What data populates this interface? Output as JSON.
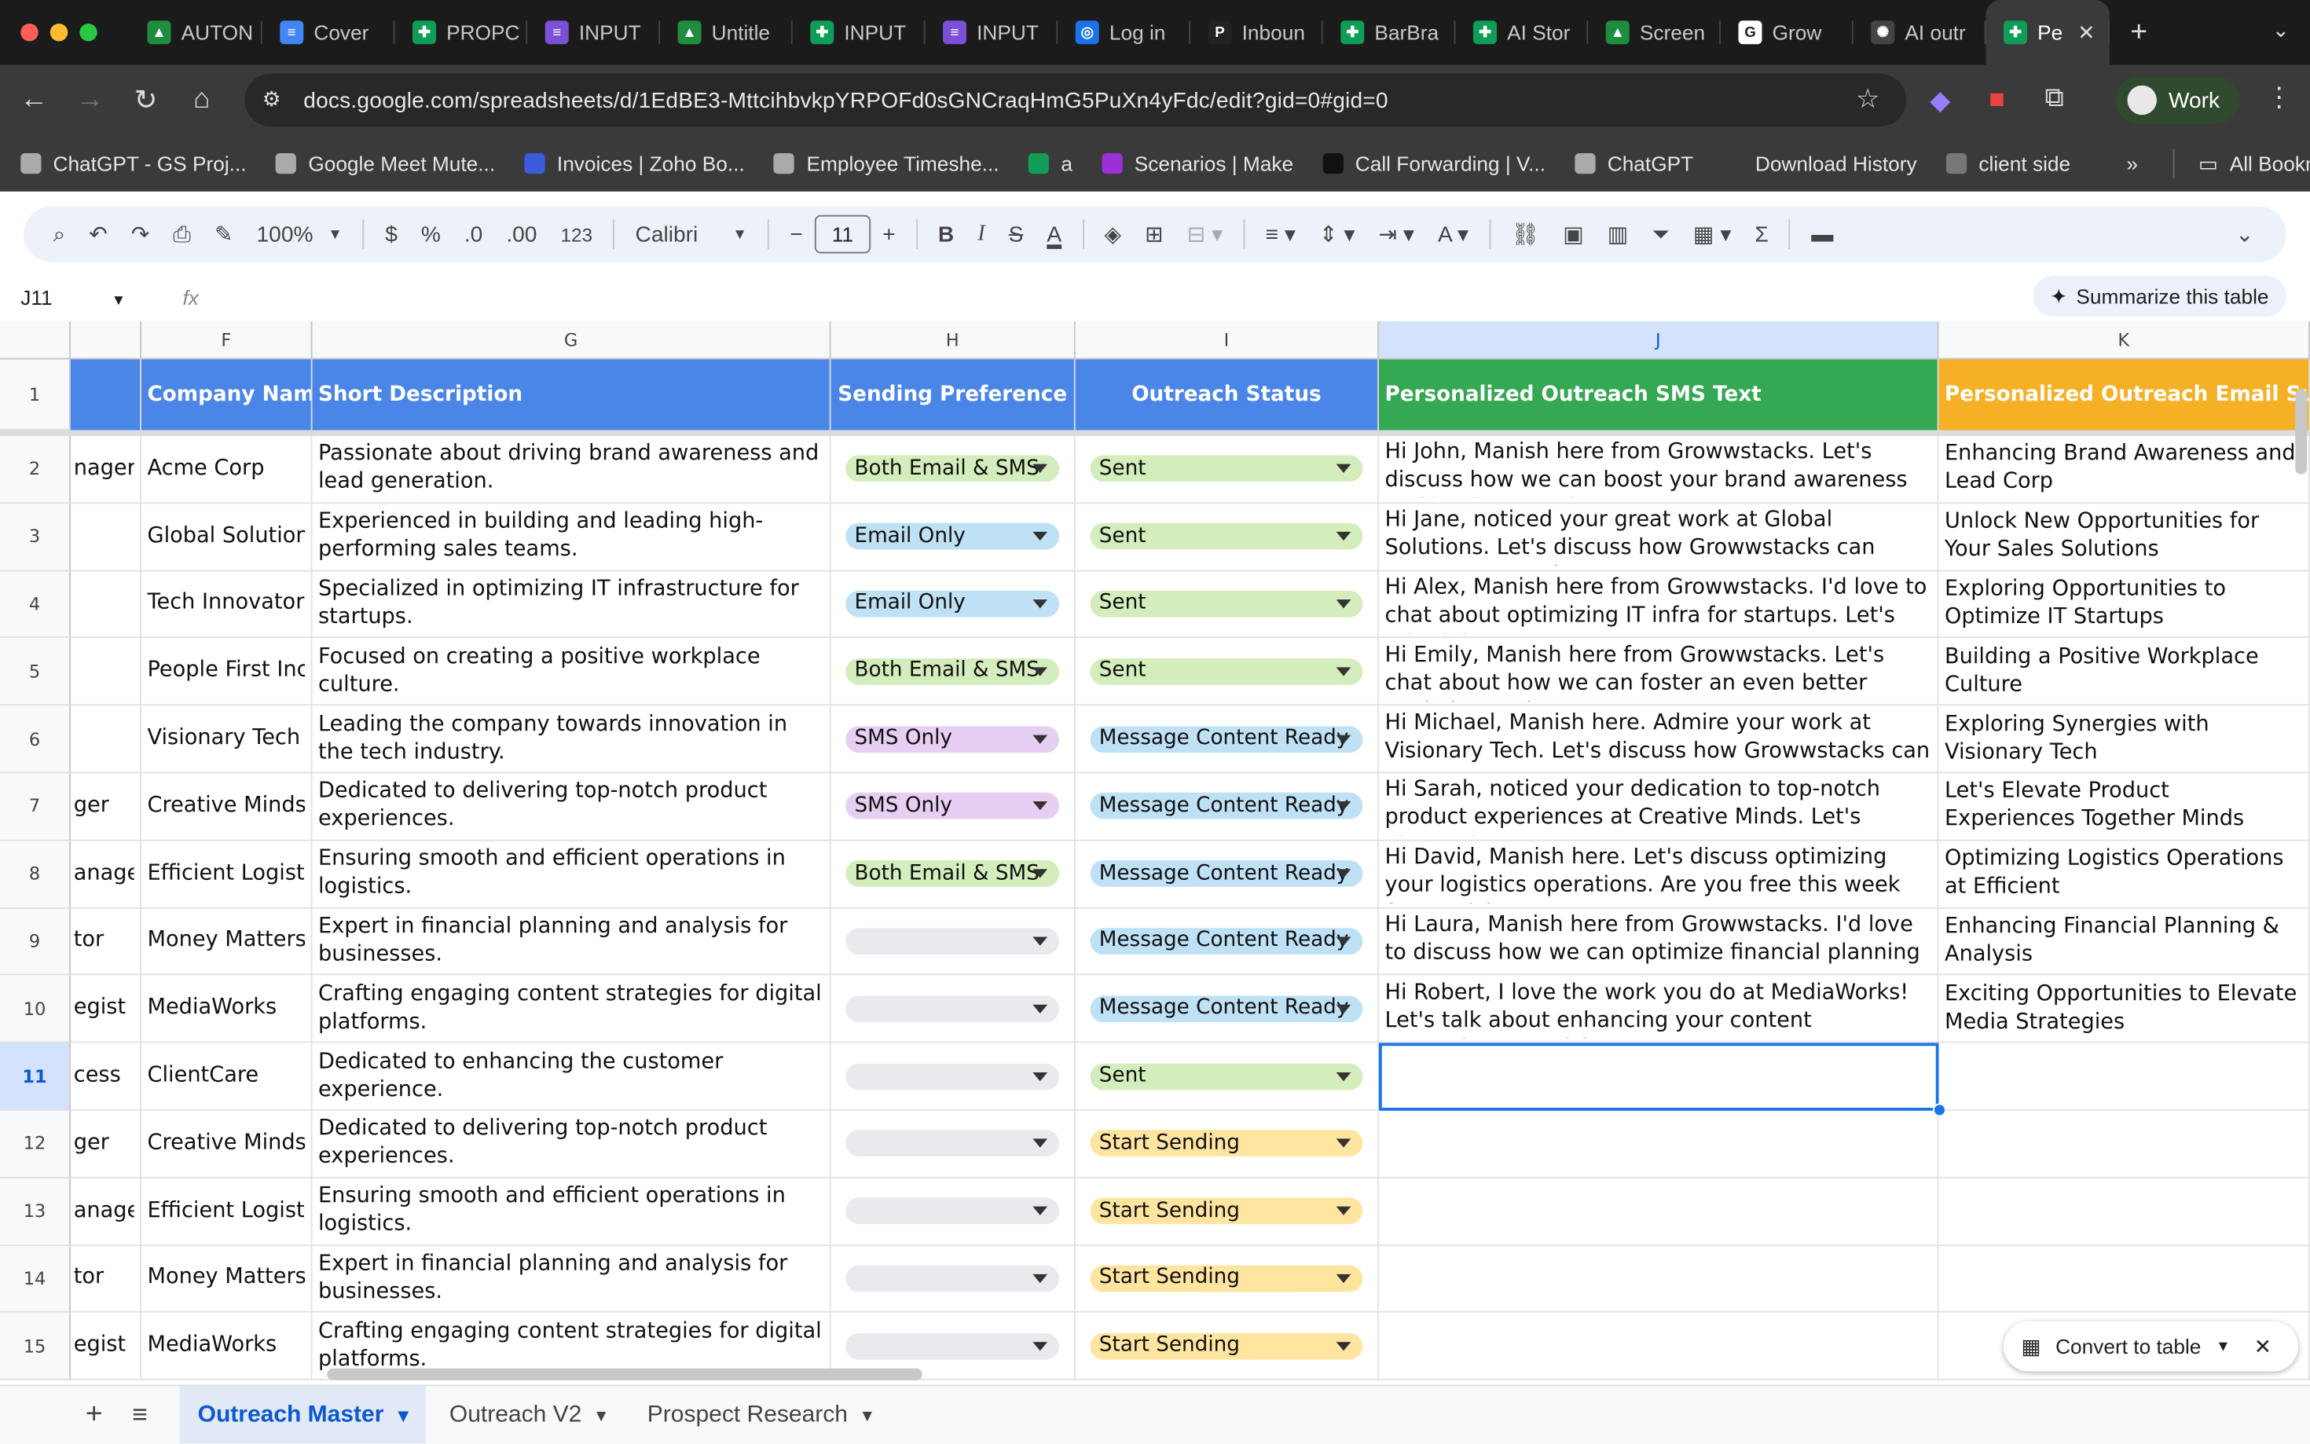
{
  "browser": {
    "tabs": [
      {
        "label": "AUTON",
        "color": "#1e8e3e",
        "glyph": "▲"
      },
      {
        "label": "Cover",
        "color": "#4285f4",
        "glyph": "≡"
      },
      {
        "label": "PROPC",
        "color": "#0f9d58",
        "glyph": "✚"
      },
      {
        "label": "INPUT",
        "color": "#7b4fd6",
        "glyph": "≡"
      },
      {
        "label": "Untitle",
        "color": "#1e8e3e",
        "glyph": "▲"
      },
      {
        "label": "INPUT",
        "color": "#0f9d58",
        "glyph": "✚"
      },
      {
        "label": "INPUT",
        "color": "#7b4fd6",
        "glyph": "≡"
      },
      {
        "label": "Log in",
        "color": "#1a73e8",
        "glyph": "◎"
      },
      {
        "label": "Inboun",
        "color": "#222222",
        "glyph": "P"
      },
      {
        "label": "BarBra",
        "color": "#0f9d58",
        "glyph": "✚"
      },
      {
        "label": "AI Stor",
        "color": "#0f9d58",
        "glyph": "✚"
      },
      {
        "label": "Screen",
        "color": "#1e8e3e",
        "glyph": "▲"
      },
      {
        "label": "Grow",
        "color": "#ffffff",
        "glyph": "G"
      },
      {
        "label": "AI outr",
        "color": "#444444",
        "glyph": "✺"
      },
      {
        "label": "Pe",
        "color": "#0f9d58",
        "glyph": "✚"
      }
    ],
    "new_tab": "+",
    "close": "✕",
    "url": "docs.google.com/spreadsheets/d/1EdBE3-MttcihbvkpYRPOFd0sGNCraqHmG5PuXn4yFdc/edit?gid=0#gid=0",
    "profile": "Work",
    "bookmarks": [
      {
        "label": "ChatGPT - GS Proj...",
        "color": "#aaaaaa"
      },
      {
        "label": "Google Meet Mute...",
        "color": "#aaaaaa"
      },
      {
        "label": "Invoices | Zoho Bo...",
        "color": "#3b5bdb"
      },
      {
        "label": "Employee Timeshe...",
        "color": "#aaaaaa"
      },
      {
        "label": "a",
        "color": "#0f9d58"
      },
      {
        "label": "Scenarios | Make",
        "color": "#9b30d9"
      },
      {
        "label": "Call Forwarding | V...",
        "color": "#111111"
      },
      {
        "label": "ChatGPT",
        "color": "#aaaaaa"
      },
      {
        "label": "Download History",
        "color": "#3a3a3a"
      },
      {
        "label": "client side",
        "color": "#777777"
      }
    ],
    "bookmarks_overflow": "»",
    "all_bookmarks": "All Bookmarks"
  },
  "toolbar": {
    "zoom": "100%",
    "currency": "$",
    "percent": "%",
    "dec_less": ".0",
    "dec_more": ".00",
    "format": "123",
    "font": "Calibri",
    "font_size": "11"
  },
  "formula": {
    "cell_ref": "J11",
    "fx": "fx",
    "summarize": "Summarize this table"
  },
  "columns": [
    {
      "letter": "F"
    },
    {
      "letter": "G"
    },
    {
      "letter": "H"
    },
    {
      "letter": "I"
    },
    {
      "letter": "J"
    },
    {
      "letter": "K"
    }
  ],
  "header": {
    "company": "Company Name",
    "desc": "Short Description",
    "pref": "Sending Preference",
    "status": "Outreach Status",
    "sms": "Personalized Outreach SMS Text",
    "subject": "Personalized Outreach Email Subject"
  },
  "rows": [
    {
      "num": "2",
      "e": "nager",
      "company": "Acme Corp",
      "desc": "Passionate about driving brand awareness and lead generation.",
      "pref": "Both Email & SMS",
      "status": "Sent",
      "sms": "Hi John, Manish here from Growwstacks. Let's discuss how we can boost your brand awareness and lead generation.",
      "subject": "Enhancing Brand Awareness and Lead Corp"
    },
    {
      "num": "3",
      "e": "",
      "company": "Global Solutions",
      "desc": "Experienced in building and leading high-performing sales teams.",
      "pref": "Email Only",
      "status": "Sent",
      "sms": "Hi Jane, noticed your great work at Global Solutions. Let's discuss how Growwstacks can support your sales teams.",
      "subject": "Unlock New Opportunities for Your Sales Solutions"
    },
    {
      "num": "4",
      "e": "",
      "company": "Tech Innovators",
      "desc": "Specialized in optimizing IT infrastructure for startups.",
      "pref": "Email Only",
      "status": "Sent",
      "sms": "Hi Alex, Manish here from Growwstacks. I'd love to chat about optimizing IT infra for startups. Let's schedule a",
      "subject": "Exploring Opportunities to Optimize IT Startups"
    },
    {
      "num": "5",
      "e": "",
      "company": "People First Inc",
      "desc": "Focused on creating a positive workplace culture.",
      "pref": "Both Email & SMS",
      "status": "Sent",
      "sms": "Hi Emily, Manish here from Growwstacks. Let's chat about how we can foster an even better workplace culture at",
      "subject": "Building a Positive Workplace Culture"
    },
    {
      "num": "6",
      "e": "",
      "company": "Visionary Tech",
      "desc": "Leading the company towards innovation in the tech industry.",
      "pref": "SMS Only",
      "status": "Message Content Ready",
      "sms": "Hi Michael, Manish here. Admire your work at Visionary Tech. Let's discuss how Growwstacks can support your",
      "subject": "Exploring Synergies with Visionary Tech"
    },
    {
      "num": "7",
      "e": "ger",
      "company": "Creative Minds",
      "desc": "Dedicated to delivering top-notch product experiences.",
      "pref": "SMS Only",
      "status": "Message Content Ready",
      "sms": "Hi Sarah, noticed your dedication to top-notch product experiences at Creative Minds. Let's discuss how",
      "subject": "Let's Elevate Product Experiences Together Minds"
    },
    {
      "num": "8",
      "e": "anager",
      "company": "Efficient Logistics",
      "desc": "Ensuring smooth and efficient operations in logistics.",
      "pref": "Both Email & SMS",
      "status": "Message Content Ready",
      "sms": "Hi David, Manish here. Let's discuss optimizing your logistics operations. Are you free this week for a quick",
      "subject": "Optimizing Logistics Operations at Efficient"
    },
    {
      "num": "9",
      "e": "tor",
      "company": "Money Matters",
      "desc": "Expert in financial planning and analysis for businesses.",
      "pref": "",
      "status": "Message Content Ready",
      "sms": "Hi Laura, Manish here from Growwstacks. I'd love to discuss how we can optimize financial planning at Money",
      "subject": "Enhancing Financial Planning & Analysis"
    },
    {
      "num": "10",
      "e": "egist",
      "company": "MediaWorks",
      "desc": "Crafting engaging content strategies for digital platforms.",
      "pref": "",
      "status": "Message Content Ready",
      "sms": "Hi Robert, I love the work you do at MediaWorks! Let's talk about enhancing your content strategies. - Manish M,",
      "subject": "Exciting Opportunities to Elevate Media Strategies"
    },
    {
      "num": "11",
      "e": "cess",
      "company": "ClientCare",
      "desc": "Dedicated to enhancing the customer experience.",
      "pref": "",
      "status": "Sent",
      "sms": "",
      "subject": ""
    },
    {
      "num": "12",
      "e": "ger",
      "company": "Creative Minds",
      "desc": "Dedicated to delivering top-notch product experiences.",
      "pref": "",
      "status": "Start Sending",
      "sms": "",
      "subject": ""
    },
    {
      "num": "13",
      "e": "anager",
      "company": "Efficient Logistics",
      "desc": "Ensuring smooth and efficient operations in logistics.",
      "pref": "",
      "status": "Start Sending",
      "sms": "",
      "subject": ""
    },
    {
      "num": "14",
      "e": "tor",
      "company": "Money Matters",
      "desc": "Expert in financial planning and analysis for businesses.",
      "pref": "",
      "status": "Start Sending",
      "sms": "",
      "subject": ""
    },
    {
      "num": "15",
      "e": "egist",
      "company": "MediaWorks",
      "desc": "Crafting engaging content strategies for digital platforms.",
      "pref": "",
      "status": "Start Sending",
      "sms": "",
      "subject": ""
    }
  ],
  "sheet_tabs": [
    "Outreach Master",
    "Outreach V2",
    "Prospect Research"
  ],
  "convert": "Convert to table",
  "colors": {
    "blue_header": "#4a86e8",
    "green_header": "#34a853",
    "yellow_header": "#f6b026",
    "chip_green": "#d4edbc",
    "chip_blue": "#bfe1f6",
    "chip_purple": "#e6cff2",
    "chip_yellow": "#ffe5a0",
    "chip_gray": "#e8eaed"
  }
}
